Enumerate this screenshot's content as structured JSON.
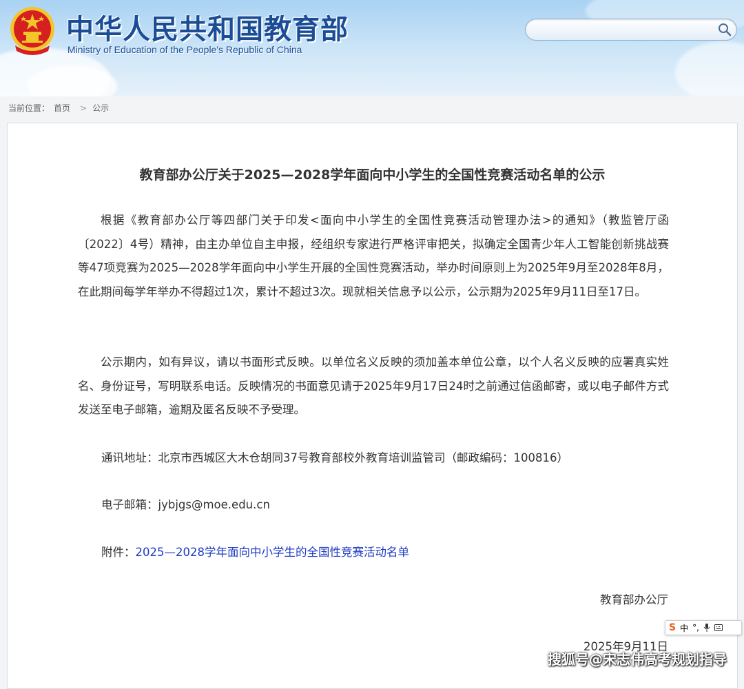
{
  "header": {
    "site_title": "中华人民共和国教育部",
    "site_subtitle": "Ministry of Education of the People's Republic of China",
    "search_placeholder": ""
  },
  "breadcrumb": {
    "label": "当前位置：",
    "home": "首页",
    "separator": ">",
    "current": "公示"
  },
  "article": {
    "title": "教育部办公厅关于2025—2028学年面向中小学生的全国性竞赛活动名单的公示",
    "para1": "根据《教育部办公厅等四部门关于印发<面向中小学生的全国性竞赛活动管理办法>的通知》（教监管厅函〔2022〕4号）精神，由主办单位自主申报，经组织专家进行严格评审把关，拟确定全国青少年人工智能创新挑战赛等47项竞赛为2025—2028学年面向中小学生开展的全国性竞赛活动，举办时间原则上为2025年9月至2028年8月，在此期间每学年举办不得超过1次，累计不超过3次。现就相关信息予以公示，公示期为2025年9月11日至17日。",
    "para2": "公示期内，如有异议，请以书面形式反映。以单位名义反映的须加盖本单位公章，以个人名义反映的应署真实姓名、身份证号，写明联系电话。反映情况的书面意见请于2025年9月17日24时之前通过信函邮寄，或以电子邮件方式发送至电子邮箱，逾期及匿名反映不予受理。",
    "address": "通讯地址：北京市西城区大木仓胡同37号教育部校外教育培训监管司（邮政编码：100816）",
    "email": "电子邮箱：jybjgs@moe.edu.cn",
    "attachment_label": "附件：",
    "attachment_link": "2025—2028学年面向中小学生的全国性竞赛活动名单",
    "signature": "教育部办公厅",
    "date": "2025年9月11日"
  },
  "ime_toolbar": {
    "logo": "S",
    "mode": "中",
    "punct": "°,",
    "mic_icon": "microphone-icon",
    "keyboard_icon": "keyboard-icon"
  },
  "watermark": "搜狐号@宋志伟高考规划指导",
  "colors": {
    "link": "#1f3cc4",
    "title_blue": "#1a4d95",
    "emblem_red": "#d61f1f",
    "emblem_gold": "#f3c52b"
  }
}
